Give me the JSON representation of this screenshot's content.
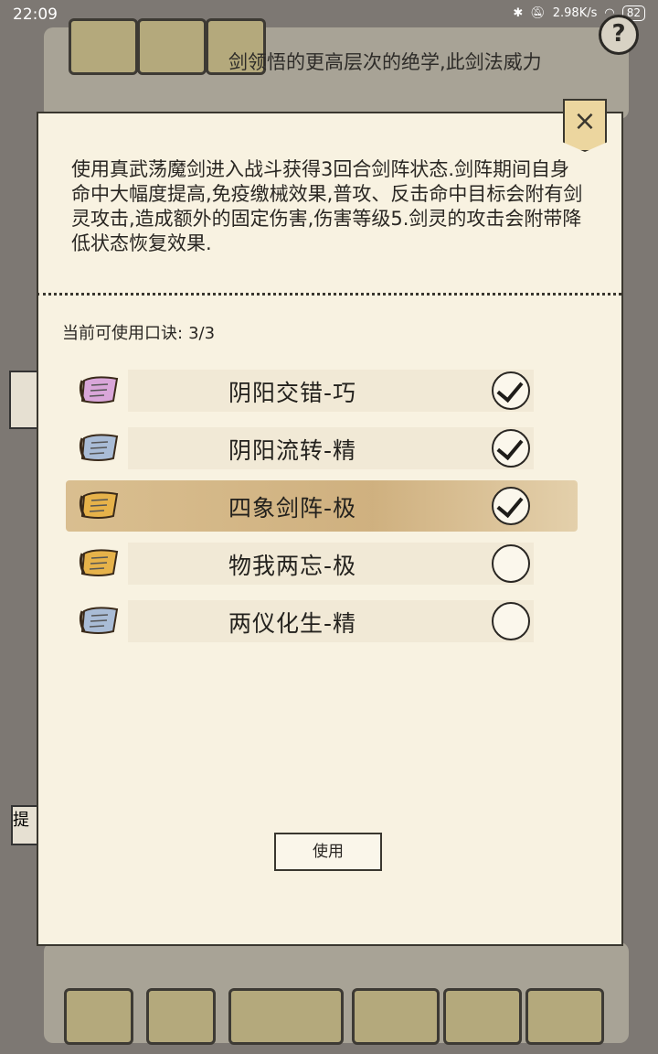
{
  "status_bar": {
    "time": "22:09",
    "net_speed": "2.98K/s",
    "battery": "82"
  },
  "background": {
    "text": "剑领悟的更高层次的绝学,此剑法威力",
    "help_label": "?",
    "tab_label": "提"
  },
  "dialog": {
    "close_label": "×",
    "description": "使用真武荡魔剑进入战斗获得3回合剑阵状态.剑阵期间自身命中大幅度提高,免疫缴械效果,普攻、反击命中目标会附有剑灵攻击,造成额外的固定伤害,伤害等级5.剑灵的攻击会附带降低状态恢复效果.",
    "count_label": "当前可使用口诀:",
    "count_value": "3/3",
    "items": [
      {
        "name": "阴阳交错-巧",
        "checked": true,
        "scroll_color": "#d9a6d9",
        "highlight": false
      },
      {
        "name": "阴阳流转-精",
        "checked": true,
        "scroll_color": "#a9bcd6",
        "highlight": false
      },
      {
        "name": "四象剑阵-极",
        "checked": true,
        "scroll_color": "#e6b24a",
        "highlight": true
      },
      {
        "name": "物我两忘-极",
        "checked": false,
        "scroll_color": "#e6b24a",
        "highlight": false
      },
      {
        "name": "两仪化生-精",
        "checked": false,
        "scroll_color": "#a9bcd6",
        "highlight": false
      }
    ],
    "use_button": "使用"
  }
}
